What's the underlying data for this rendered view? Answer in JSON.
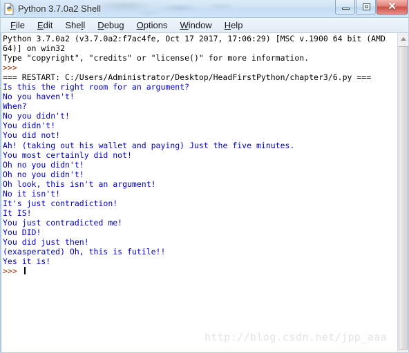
{
  "window": {
    "title": "Python 3.7.0a2 Shell",
    "icon": "python-idle-icon",
    "controls": {
      "minimize_label": "",
      "maximize_label": "",
      "close_label": "✕"
    }
  },
  "menubar": {
    "items": [
      {
        "label": "File",
        "accel": "F"
      },
      {
        "label": "Edit",
        "accel": "E"
      },
      {
        "label": "Shell",
        "accel": "l"
      },
      {
        "label": "Debug",
        "accel": "D"
      },
      {
        "label": "Options",
        "accel": "O"
      },
      {
        "label": "Window",
        "accel": "W"
      },
      {
        "label": "Help",
        "accel": "H"
      }
    ]
  },
  "shell": {
    "lines": [
      {
        "text": "Python 3.7.0a2 (v3.7.0a2:f7ac4fe, Oct 17 2017, 17:06:29) [MSC v.1900 64 bit (AMD",
        "color": "black"
      },
      {
        "text": "64)] on win32",
        "color": "black"
      },
      {
        "text": "Type \"copyright\", \"credits\" or \"license()\" for more information.",
        "color": "black"
      },
      {
        "text": ">>> ",
        "color": "brown"
      },
      {
        "text": "=== RESTART: C:/Users/Administrator/Desktop/HeadFirstPython/chapter3/6.py ===",
        "color": "black"
      },
      {
        "text": "Is this the right room for an argument?",
        "color": "blue"
      },
      {
        "text": "No you haven't!",
        "color": "blue"
      },
      {
        "text": "When?",
        "color": "blue"
      },
      {
        "text": "No you didn't!",
        "color": "blue"
      },
      {
        "text": "You didn't!",
        "color": "blue"
      },
      {
        "text": "You did not!",
        "color": "blue"
      },
      {
        "text": "Ah! (taking out his wallet and paying) Just the five minutes.",
        "color": "blue"
      },
      {
        "text": "You most certainly did not!",
        "color": "blue"
      },
      {
        "text": "Oh no you didn't!",
        "color": "blue"
      },
      {
        "text": "Oh no you didn't!",
        "color": "blue"
      },
      {
        "text": "Oh look, this isn't an argument!",
        "color": "blue"
      },
      {
        "text": "No it isn't!",
        "color": "blue"
      },
      {
        "text": "It's just contradiction!",
        "color": "blue"
      },
      {
        "text": "It IS!",
        "color": "blue"
      },
      {
        "text": "You just contradicted me!",
        "color": "blue"
      },
      {
        "text": "You DID!",
        "color": "blue"
      },
      {
        "text": "You did just then!",
        "color": "blue"
      },
      {
        "text": "(exasperated) Oh, this is futile!!",
        "color": "blue"
      },
      {
        "text": "Yes it is!",
        "color": "blue"
      }
    ],
    "prompt": ">>> ",
    "prompt_color": "#993300",
    "output_color": "#0000cc",
    "text_color": "#000000",
    "background": "#ffffff"
  },
  "scrollbar": {
    "up_arrow": "scroll-up-arrow",
    "position_percent": 0
  },
  "watermark": {
    "text": "http://blog.csdn.net/jpp_aaa"
  }
}
